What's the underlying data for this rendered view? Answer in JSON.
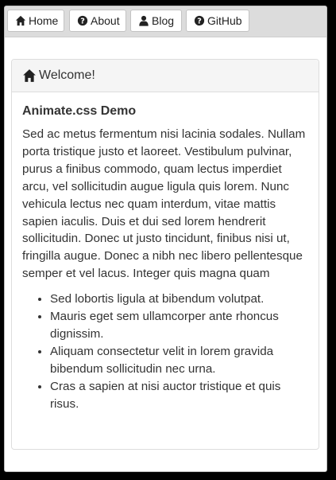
{
  "nav": {
    "buttons": [
      {
        "label": "Home",
        "icon": "home-icon"
      },
      {
        "label": "About",
        "icon": "question-circle-icon"
      },
      {
        "label": "Blog",
        "icon": "user-icon"
      },
      {
        "label": "GitHub",
        "icon": "question-circle-icon"
      }
    ]
  },
  "panel": {
    "heading": "Welcome!",
    "heading_icon": "home-icon",
    "title": "Animate.css Demo",
    "paragraph": "Sed ac metus fermentum nisi lacinia sodales. Nullam porta tristique justo et laoreet. Vestibulum pulvinar, purus a finibus commodo, quam lectus imperdiet arcu, vel sollicitudin augue ligula quis lorem. Nunc vehicula lectus nec quam interdum, vitae mattis sapien iaculis. Duis et dui sed lorem hendrerit sollicitudin. Donec ut justo tincidunt, finibus nisi ut, fringilla augue. Donec a nibh nec libero pellentesque semper et vel lacus. Integer quis magna quam",
    "list": [
      "Sed lobortis ligula at bibendum volutpat.",
      "Mauris eget sem ullamcorper ante rhoncus dignissim.",
      "Aliquam consectetur velit in lorem gravida bibendum sollicitudin nec urna.",
      "Cras a sapien at nisi auctor tristique et quis risus."
    ]
  },
  "colors": {
    "navbar_bg": "#dcdcdc",
    "panel_heading_bg": "#f5f5f5",
    "text": "#333333",
    "outer_bg": "#000000"
  }
}
